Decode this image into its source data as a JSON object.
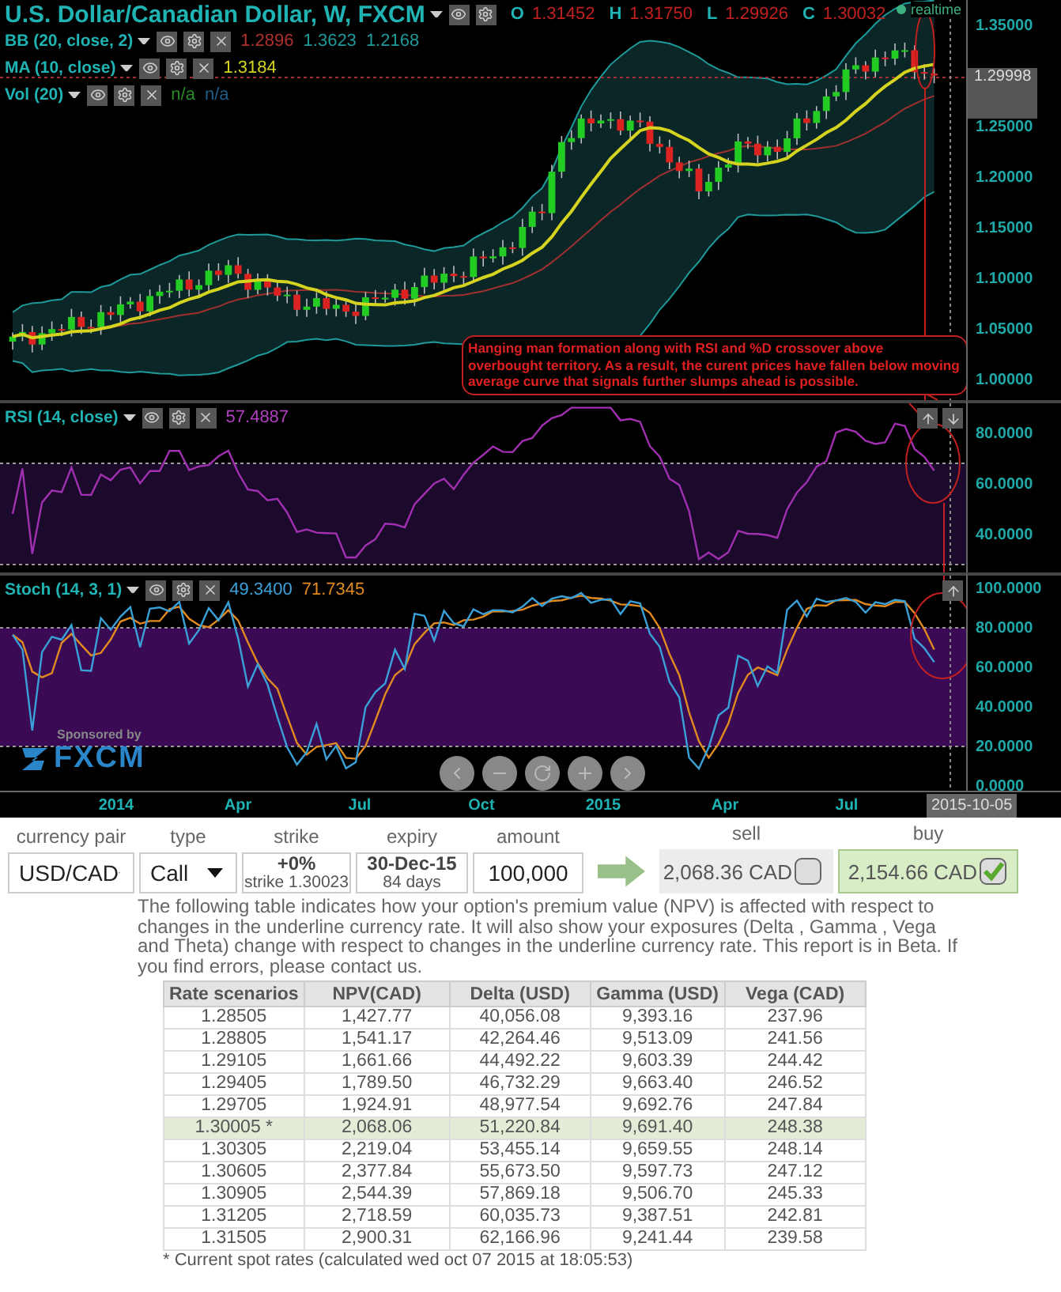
{
  "chart": {
    "symbol": "U.S. Dollar/Canadian Dollar, W, FXCM",
    "ohlc": [
      {
        "label": "O",
        "value": "1.31452"
      },
      {
        "label": "H",
        "value": "1.31750"
      },
      {
        "label": "L",
        "value": "1.29926"
      },
      {
        "label": "C",
        "value": "1.30032"
      }
    ],
    "indicators": [
      {
        "name": "BB (20, close, 2)",
        "values": [
          {
            "text": "1.2896",
            "color": "#b03030"
          },
          {
            "text": "1.3623",
            "color": "#1f9a9a"
          },
          {
            "text": "1.2168",
            "color": "#1f9a9a"
          }
        ]
      },
      {
        "name": "MA (10, close)",
        "values": [
          {
            "text": "1.3184",
            "color": "#d4d420"
          }
        ]
      },
      {
        "name": "Vol (20)",
        "values": [
          {
            "text": "n/a",
            "color": "#2a8a2a"
          },
          {
            "text": "n/a",
            "color": "#1f5f8a"
          }
        ]
      }
    ],
    "realtime": "realtime",
    "price_axis": [
      "1.35000",
      "1.29998",
      "1.25000",
      "1.20000",
      "1.15000",
      "1.10000",
      "1.05000",
      "1.00000"
    ],
    "annotation": "Hanging man formation along with RSI and %D crossover above overbought territory. As a result, the curent prices have fallen below moving average curve that signals further slumps ahead is possible.",
    "rsi": {
      "name": "RSI (14, close)",
      "values": [
        {
          "text": "57.4887",
          "color": "#b040c0"
        }
      ],
      "axis": [
        "80.0000",
        "60.0000",
        "40.0000"
      ]
    },
    "stoch": {
      "name": "Stoch (14, 3, 1)",
      "values": [
        {
          "text": "49.3400",
          "color": "#3aa0d8"
        },
        {
          "text": "71.7345",
          "color": "#e08a20"
        }
      ],
      "axis": [
        "100.0000",
        "80.0000",
        "60.0000",
        "40.0000",
        "20.0000",
        "0.0000"
      ]
    },
    "sponsor": "Sponsored by",
    "sponsor_logo": "FXCM",
    "time_axis": [
      "2014",
      "Apr",
      "Jul",
      "Oct",
      "2015",
      "Apr",
      "Jul"
    ],
    "cursor_date": "2015-10-05"
  },
  "form": {
    "fields": [
      {
        "label": "currency pair",
        "kind": "select",
        "value": "USD/CAD"
      },
      {
        "label": "type",
        "kind": "select",
        "value": "Call"
      },
      {
        "label": "strike",
        "kind": "stack",
        "value": "+0%",
        "sub": "strike 1.30023"
      },
      {
        "label": "expiry",
        "kind": "stack",
        "value": "30-Dec-15",
        "sub": "84 days"
      },
      {
        "label": "amount",
        "kind": "input",
        "value": "100,000"
      }
    ],
    "quotes": [
      {
        "label": "sell",
        "price": "2,068.36 CAD",
        "selected": false
      },
      {
        "label": "buy",
        "price": "2,154.66 CAD",
        "selected": true
      }
    ]
  },
  "description": "The following table indicates how your option's premium value (NPV) is affected with respect to changes in the underline currency rate. It will also show your exposures (Delta , Gamma , Vega and Theta) change with respect to changes in the underline currency rate. This report is in Beta. If you find errors, please contact us.",
  "table": {
    "columns": [
      "Rate scenarios",
      "NPV(CAD)",
      "Delta (USD)",
      "Gamma (USD)",
      "Vega (CAD)"
    ],
    "rows": [
      {
        "cells": [
          "1.28505",
          "1,427.77",
          "40,056.08",
          "9,393.16",
          "237.96"
        ],
        "selected": false
      },
      {
        "cells": [
          "1.28805",
          "1,541.17",
          "42,264.46",
          "9,513.09",
          "241.56"
        ],
        "selected": false
      },
      {
        "cells": [
          "1.29105",
          "1,661.66",
          "44,492.22",
          "9,603.39",
          "244.42"
        ],
        "selected": false
      },
      {
        "cells": [
          "1.29405",
          "1,789.50",
          "46,732.29",
          "9,663.40",
          "246.52"
        ],
        "selected": false
      },
      {
        "cells": [
          "1.29705",
          "1,924.91",
          "48,977.54",
          "9,692.76",
          "247.84"
        ],
        "selected": false
      },
      {
        "cells": [
          "1.30005 *",
          "2,068.06",
          "51,220.84",
          "9,691.40",
          "248.38"
        ],
        "selected": true
      },
      {
        "cells": [
          "1.30305",
          "2,219.04",
          "53,455.14",
          "9,659.55",
          "248.14"
        ],
        "selected": false
      },
      {
        "cells": [
          "1.30605",
          "2,377.84",
          "55,673.50",
          "9,597.73",
          "247.12"
        ],
        "selected": false
      },
      {
        "cells": [
          "1.30905",
          "2,544.39",
          "57,869.18",
          "9,506.70",
          "245.33"
        ],
        "selected": false
      },
      {
        "cells": [
          "1.31205",
          "2,718.59",
          "60,035.73",
          "9,387.51",
          "242.81"
        ],
        "selected": false
      },
      {
        "cells": [
          "1.31505",
          "2,900.31",
          "62,166.96",
          "9,241.44",
          "239.58"
        ],
        "selected": false
      }
    ]
  },
  "footnote": "* Current spot rates (calculated wed oct 07 2015 at 18:05:53)"
}
